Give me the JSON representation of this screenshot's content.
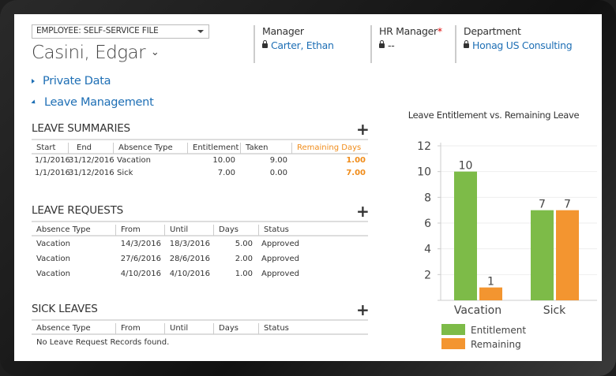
{
  "header": {
    "form_selector": "EMPLOYEE: SELF-SERVICE FILE",
    "record_name": "Casini, Edgar",
    "fields": [
      {
        "label": "Manager",
        "value": "Carter, Ethan",
        "required": false
      },
      {
        "label": "HR Manager",
        "value": "--",
        "required": true,
        "required_mark": "*"
      },
      {
        "label": "Department",
        "value": "Honag US Consulting",
        "required": false
      }
    ]
  },
  "sections": {
    "private_data": "Private Data",
    "leave_management": "Leave Management"
  },
  "leave_summaries": {
    "title": "LEAVE SUMMARIES",
    "columns": [
      "Start",
      "End",
      "Absence Type",
      "Entitlement",
      "Taken",
      "Remaining Days"
    ],
    "rows": [
      [
        "1/1/2016",
        "31/12/2016",
        "Vacation",
        "10.00",
        "9.00",
        "1.00"
      ],
      [
        "1/1/2016",
        "31/12/2016",
        "Sick",
        "7.00",
        "0.00",
        "7.00"
      ]
    ]
  },
  "leave_requests": {
    "title": "LEAVE REQUESTS",
    "columns": [
      "Absence Type",
      "From",
      "Until",
      "Days",
      "Status"
    ],
    "rows": [
      [
        "Vacation",
        "14/3/2016",
        "18/3/2016",
        "5.00",
        "Approved"
      ],
      [
        "Vacation",
        "27/6/2016",
        "28/6/2016",
        "2.00",
        "Approved"
      ],
      [
        "Vacation",
        "4/10/2016",
        "4/10/2016",
        "1.00",
        "Approved"
      ]
    ]
  },
  "sick_leaves": {
    "title": "SICK LEAVES",
    "columns": [
      "Absence Type",
      "From",
      "Until",
      "Days",
      "Status"
    ],
    "empty_message": "No Leave Request Records found."
  },
  "colors": {
    "link": "#1e6fb5",
    "accent": "#f08c1a",
    "entitlement": "#7dbb48",
    "remaining": "#f39530"
  },
  "chart_data": {
    "type": "bar",
    "title": "Leave Entitlement vs. Remaining Leave",
    "categories": [
      "Vacation",
      "Sick"
    ],
    "series": [
      {
        "name": "Entitlement",
        "values": [
          10,
          7
        ],
        "color": "#7dbb48"
      },
      {
        "name": "Remaining",
        "values": [
          1,
          7
        ],
        "color": "#f39530"
      }
    ],
    "ylim": [
      0,
      12
    ],
    "yticks": [
      "2",
      "4",
      "6",
      "8",
      "10",
      "12"
    ],
    "data_labels": [
      [
        "10",
        "7"
      ],
      [
        "1",
        "7"
      ]
    ],
    "grid": true,
    "legend": "bottom-left"
  }
}
